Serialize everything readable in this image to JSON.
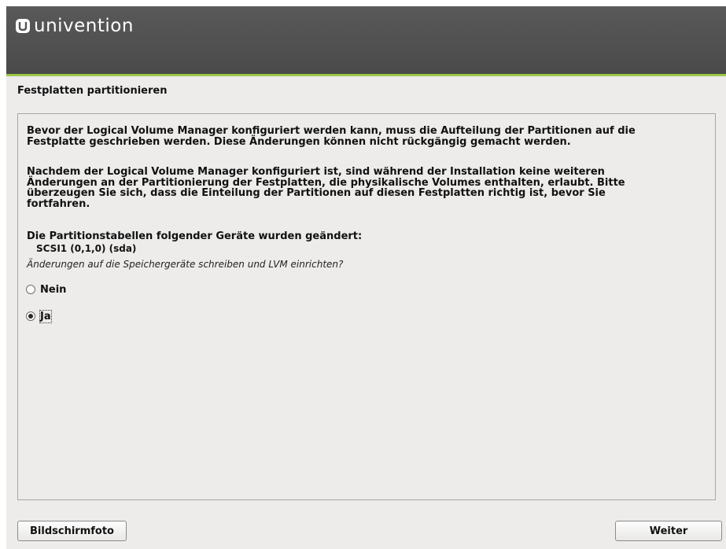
{
  "header": {
    "logo_text": "univention"
  },
  "page": {
    "title": "Festplatten partitionieren"
  },
  "content": {
    "paragraph1_lines": [
      "Bevor der Logical Volume Manager konfiguriert werden kann, muss die Aufteilung der Partitionen auf die",
      "Festplatte geschrieben werden. Diese Änderungen können nicht rückgängig gemacht werden."
    ],
    "paragraph2_lines": [
      "Nachdem der Logical Volume Manager konfiguriert ist, sind während der Installation keine weiteren",
      "Änderungen an der Partitionierung der Festplatten, die physikalische Volumes enthalten, erlaubt. Bitte",
      "überzeugen Sie sich, dass die Einteilung der Partitionen auf diesen Festplatten richtig ist, bevor Sie",
      "fortfahren."
    ],
    "paragraph3": "Die Partitionstabellen folgender Geräte wurden geändert:",
    "device": "SCSI1 (0,1,0) (sda)",
    "question": "Änderungen auf die Speichergeräte schreiben und LVM einrichten?",
    "options": [
      {
        "label": "Nein",
        "selected": false
      },
      {
        "label": "Ja",
        "selected": true
      }
    ]
  },
  "footer": {
    "screenshot_label": "Bildschirmfoto",
    "continue_label": "Weiter"
  }
}
